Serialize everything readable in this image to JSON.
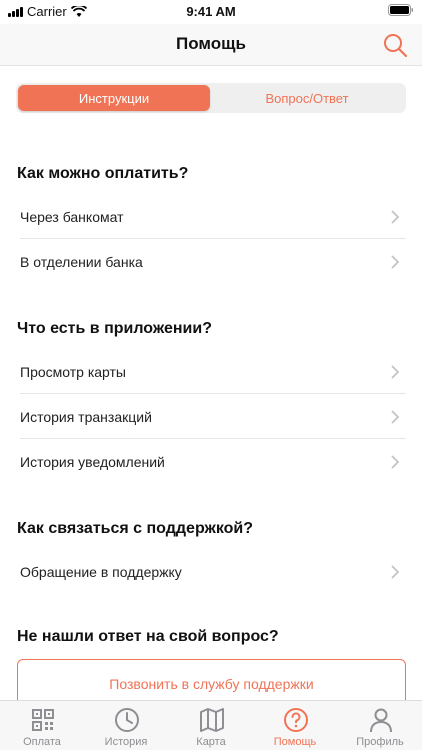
{
  "status": {
    "carrier": "Carrier",
    "time": "9:41 AM"
  },
  "nav": {
    "title": "Помощь"
  },
  "segments": {
    "active": "Инструкции",
    "inactive": "Вопрос/Ответ"
  },
  "sections": [
    {
      "title": "Как можно оплатить?",
      "items": [
        "Через банкомат",
        "В отделении банка"
      ]
    },
    {
      "title": "Что есть в приложении?",
      "items": [
        "Просмотр карты",
        "История транзакций",
        "История уведомлений"
      ]
    },
    {
      "title": "Как связаться с поддержкой?",
      "items": [
        "Обращение в поддержку"
      ]
    }
  ],
  "not_found": {
    "title": "Не нашли ответ на свой вопрос?",
    "button": "Позвонить в службу поддержки"
  },
  "tabs": [
    {
      "label": "Оплата",
      "icon": "qr-code-icon"
    },
    {
      "label": "История",
      "icon": "clock-icon"
    },
    {
      "label": "Карта",
      "icon": "map-icon"
    },
    {
      "label": "Помощь",
      "icon": "question-icon",
      "active": true
    },
    {
      "label": "Профиль",
      "icon": "person-icon"
    }
  ],
  "colors": {
    "accent": "#f07356",
    "inactive": "#8e8e93"
  }
}
